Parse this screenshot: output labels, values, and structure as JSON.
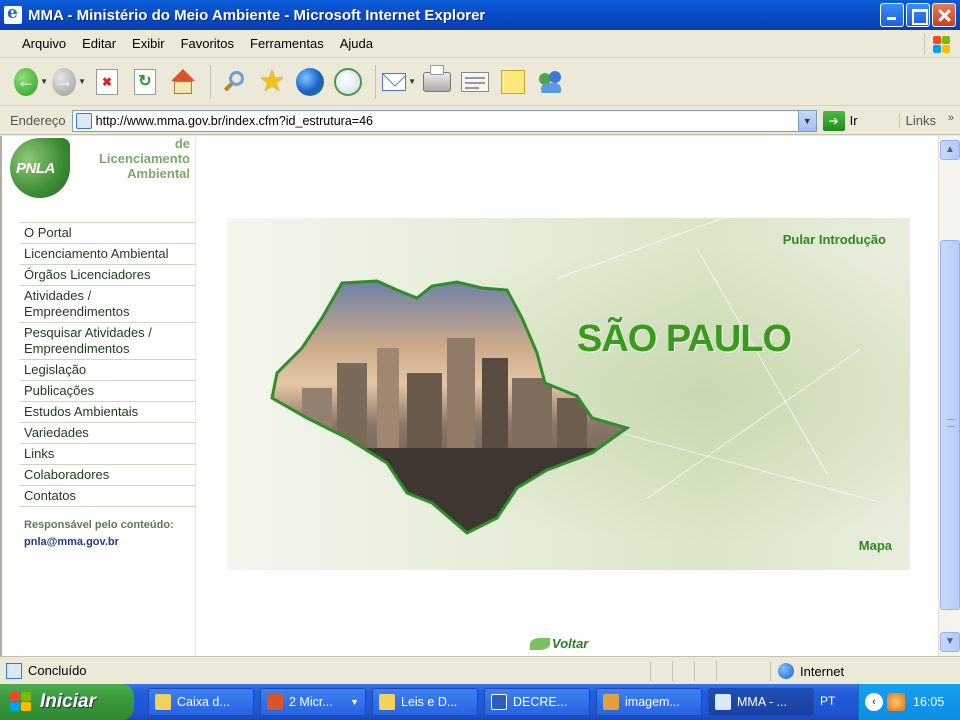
{
  "window": {
    "title": "MMA - Ministério do Meio Ambiente - Microsoft Internet Explorer"
  },
  "menu": [
    "Arquivo",
    "Editar",
    "Exibir",
    "Favoritos",
    "Ferramentas",
    "Ajuda"
  ],
  "toolbar_icons": [
    "back-icon",
    "forward-icon",
    "stop-icon",
    "refresh-icon",
    "home-icon",
    "search-icon",
    "favorites-icon",
    "media-icon",
    "history-icon",
    "mail-icon",
    "print-icon",
    "edit-icon",
    "discuss-icon",
    "messenger-icon"
  ],
  "address": {
    "label": "Endereço",
    "url": "http://www.mma.gov.br/index.cfm?id_estrutura=46",
    "go": "Ir",
    "links": "Links"
  },
  "site": {
    "logo_abbr": "PNLA",
    "logo_text": [
      "de",
      "Licenciamento",
      "Ambiental"
    ],
    "nav": [
      [
        "O Portal"
      ],
      [
        "Licenciamento Ambiental"
      ],
      [
        "Órgãos Licenciadores"
      ],
      [
        "Atividades /",
        "Empreendimentos"
      ],
      [
        "Pesquisar Atividades /",
        "Empreendimentos"
      ],
      [
        "Legislação"
      ],
      [
        "Publicações"
      ],
      [
        "Estudos Ambientais"
      ],
      [
        "Variedades"
      ],
      [
        "Links"
      ],
      [
        "Colaboradores"
      ],
      [
        "Contatos"
      ]
    ],
    "responsible_label": "Responsável pelo conteúdo:",
    "responsible_email": "pnla@mma.gov.br",
    "intro": {
      "skip": "Pular Introdução",
      "state": "SÃO PAULO",
      "map": "Mapa"
    },
    "back": "Voltar"
  },
  "status": {
    "text": "Concluído",
    "zone": "Internet"
  },
  "taskbar": {
    "start": "Iniciar",
    "tasks": [
      {
        "label": "Caixa d...",
        "icon": "outlook-icon"
      },
      {
        "label": "2 Micr...",
        "icon": "powerpoint-icon"
      },
      {
        "label": "Leis e D...",
        "icon": "folder-icon"
      },
      {
        "label": "DECRE...",
        "icon": "word-icon"
      },
      {
        "label": "imagem...",
        "icon": "paint-icon"
      },
      {
        "label": "MMA - ...",
        "icon": "ie-icon"
      }
    ],
    "lang": "PT",
    "clock": "16:05"
  },
  "colors": {
    "accent_green": "#2e8a1e",
    "xp_blue": "#0A4ECB"
  }
}
